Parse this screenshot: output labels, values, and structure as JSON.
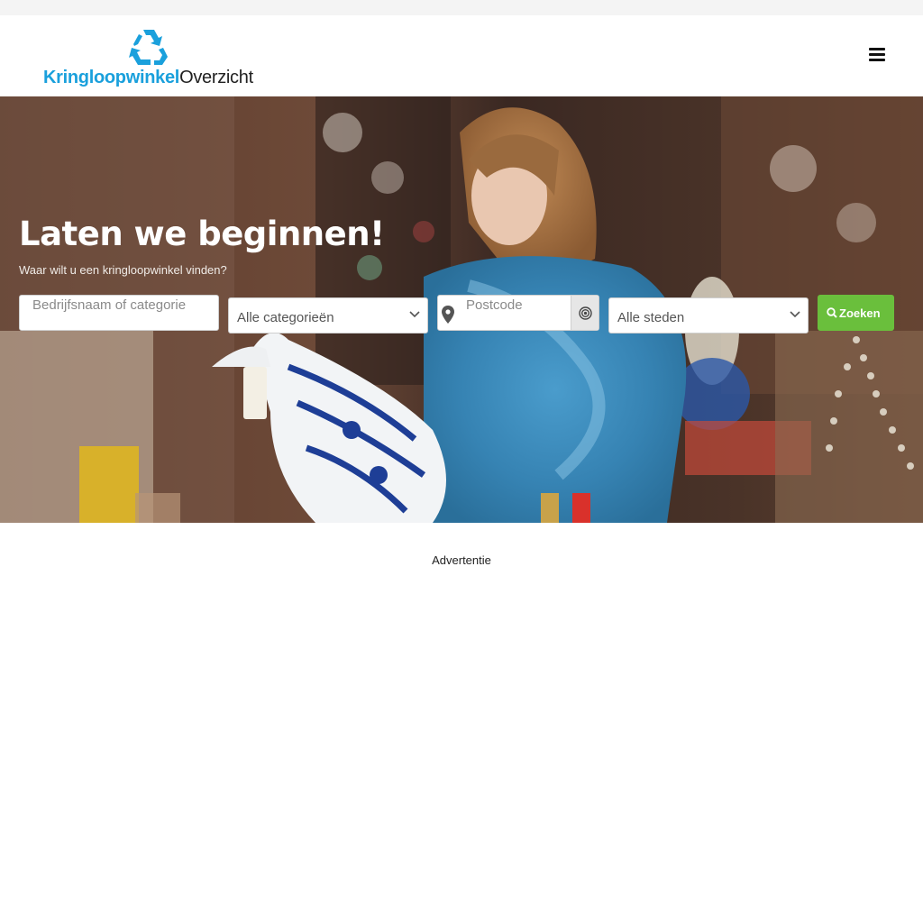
{
  "header": {
    "logo_part1": "Kringloopwinkel",
    "logo_part2": "Overzicht",
    "logo_icon": "recycle-icon",
    "menu_icon": "hamburger-menu-icon"
  },
  "hero": {
    "title": "Laten we beginnen!",
    "subtitle": "Waar wilt u een kringloopwinkel vinden?"
  },
  "search": {
    "name_placeholder": "Bedrijfsnaam of categorie",
    "category_selected": "Alle categorieën",
    "postcode_placeholder": "Postcode",
    "city_selected": "Alle steden",
    "button_label": "Zoeken"
  },
  "advert": {
    "label": "Advertentie"
  },
  "colors": {
    "brand_blue": "#1aa0dc",
    "search_green": "#6abf3c"
  }
}
